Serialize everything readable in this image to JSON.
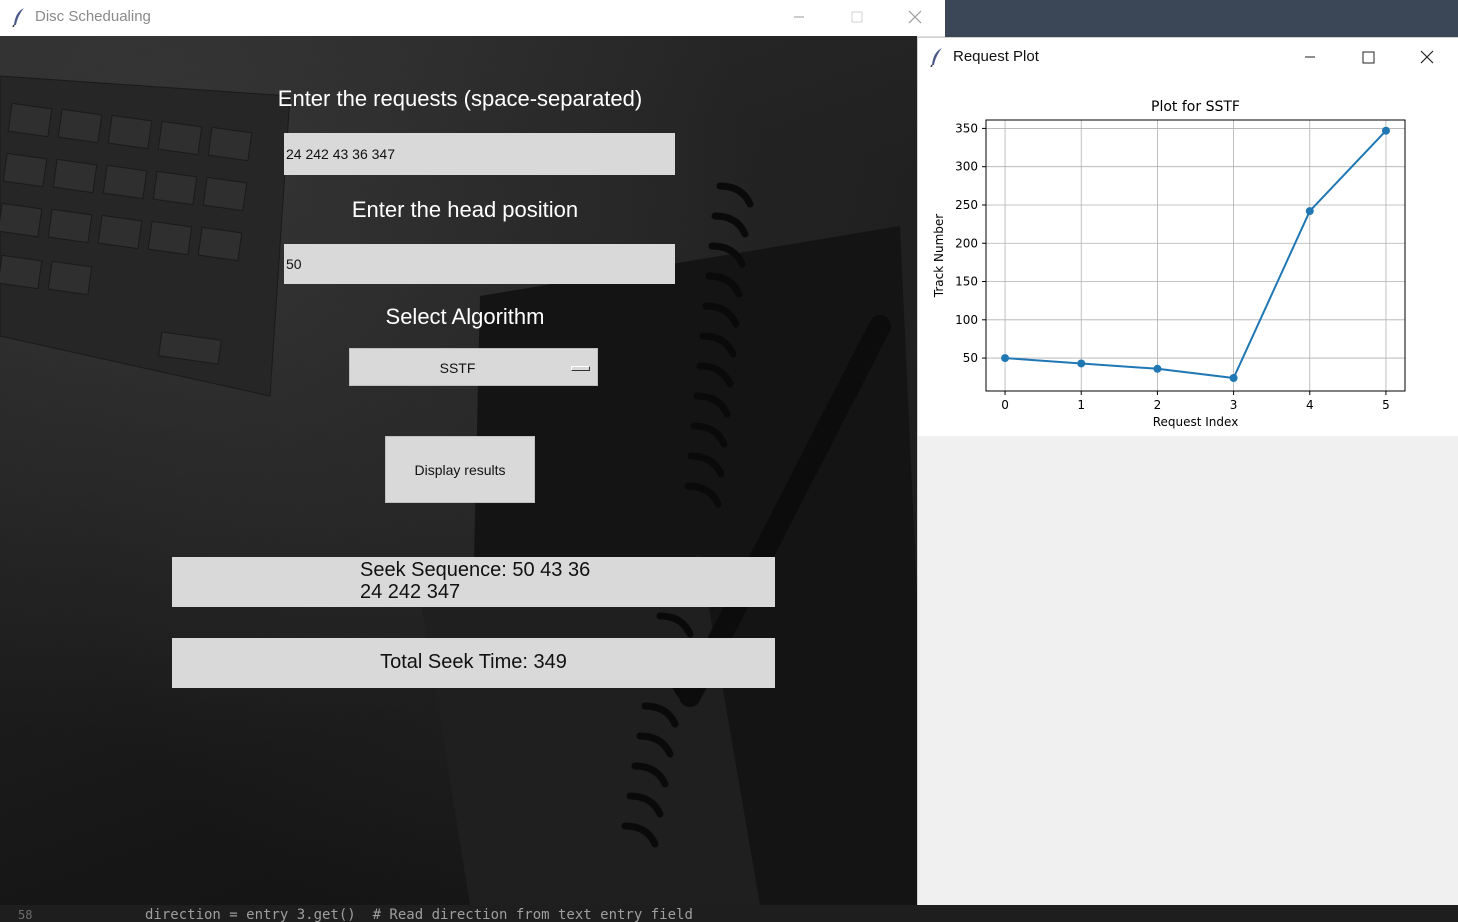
{
  "main_window": {
    "title": "Disc Schedualing",
    "requests_label": "Enter the requests (space-separated)",
    "requests_value": "24 242 43 36 347",
    "head_label": "Enter the head position",
    "head_value": "50",
    "algorithm_label": "Select Algorithm",
    "algorithm_selected": "SSTF",
    "display_button": "Display results",
    "seek_sequence_line1": "Seek Sequence: 50 43 36",
    "seek_sequence_line2": "24 242 347",
    "total_seek_time": "Total Seek Time: 349"
  },
  "plot_window": {
    "title": "Request Plot"
  },
  "editor_strip": {
    "line_number": "58",
    "code": "direction = entry_3.get()  # Read direction from text entry field"
  },
  "colors": {
    "line": "#1f77b4",
    "entry_bg": "#d9d9d9"
  },
  "chart_data": {
    "type": "line",
    "title": "Plot for  SSTF",
    "xlabel": "Request Index",
    "ylabel": "Track Number",
    "x": [
      0,
      1,
      2,
      3,
      4,
      5
    ],
    "x_ticks": [
      "0",
      "1",
      "2",
      "3",
      "4",
      "5"
    ],
    "y": [
      50,
      43,
      36,
      24,
      242,
      347
    ],
    "y_ticks": [
      "50",
      "100",
      "150",
      "200",
      "250",
      "300",
      "350"
    ],
    "xlim": [
      -0.25,
      5.25
    ],
    "ylim": [
      7,
      361
    ],
    "grid": true
  }
}
